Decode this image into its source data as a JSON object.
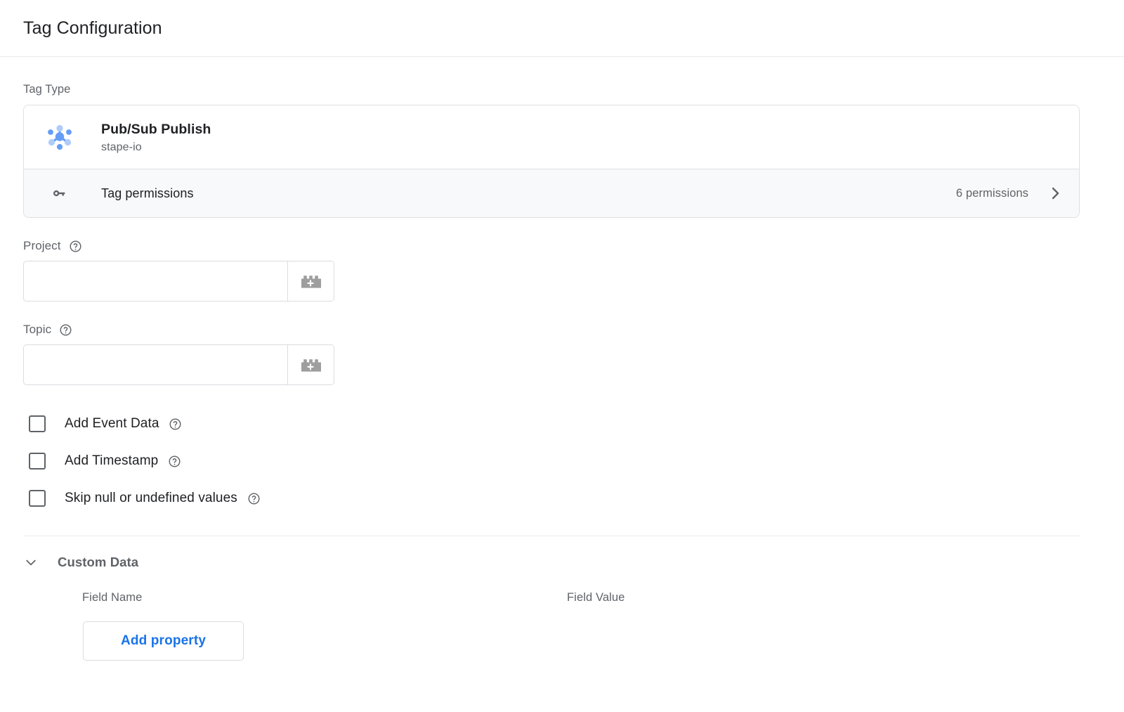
{
  "header": {
    "title": "Tag Configuration"
  },
  "tag_type": {
    "section_label": "Tag Type",
    "name": "Pub/Sub Publish",
    "vendor": "stape-io",
    "icon": "pubsub-node-graph-icon",
    "permissions": {
      "label": "Tag permissions",
      "count_text": "6 permissions",
      "icon": "key-icon",
      "chevron": "chevron-right-icon"
    }
  },
  "fields": [
    {
      "label": "Project",
      "value": "",
      "placeholder": "",
      "help_icon": "help-circle-icon",
      "variable_button_icon": "variable-brick-plus-icon"
    },
    {
      "label": "Topic",
      "value": "",
      "placeholder": "",
      "help_icon": "help-circle-icon",
      "variable_button_icon": "variable-brick-plus-icon"
    }
  ],
  "checkboxes": [
    {
      "label": "Add Event Data",
      "checked": false,
      "help_icon": "help-circle-icon"
    },
    {
      "label": "Add Timestamp",
      "checked": false,
      "help_icon": "help-circle-icon"
    },
    {
      "label": "Skip null or undefined values",
      "checked": false,
      "help_icon": "help-circle-icon"
    }
  ],
  "custom_data": {
    "title": "Custom Data",
    "expanded": true,
    "chevron_icon": "chevron-down-icon",
    "columns": {
      "field_name": "Field Name",
      "field_value": "Field Value"
    },
    "rows": [],
    "add_button_label": "Add property"
  },
  "colors": {
    "accent_blue": "#1a73e8",
    "icon_blue_light": "#aecbfa",
    "icon_blue_mid": "#669df6",
    "text_primary": "#202124",
    "text_secondary": "#5f6368",
    "border": "#dadce0",
    "row_background": "#f8f9fa"
  }
}
